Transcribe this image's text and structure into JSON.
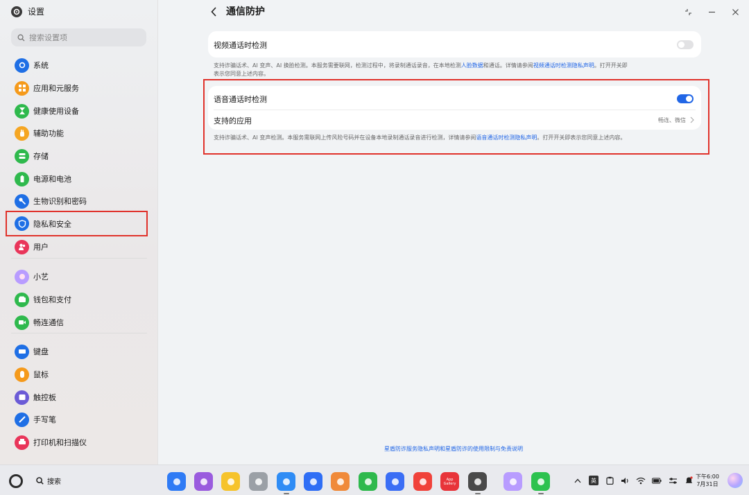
{
  "app": {
    "title": "设置"
  },
  "search": {
    "placeholder": "搜索设置项"
  },
  "sidebar": {
    "items": [
      {
        "label": "系统",
        "icon": "gear-icon",
        "color": "#1f6fe5"
      },
      {
        "label": "应用和元服务",
        "icon": "apps-grid-icon",
        "color": "#f59a1b"
      },
      {
        "label": "健康使用设备",
        "icon": "hourglass-icon",
        "color": "#2fb94d"
      },
      {
        "label": "辅助功能",
        "icon": "hand-icon",
        "color": "#f5a623"
      },
      {
        "label": "存储",
        "icon": "storage-icon",
        "color": "#2fb94d"
      },
      {
        "label": "电源和电池",
        "icon": "battery-icon",
        "color": "#2fb94d"
      },
      {
        "label": "生物识别和密码",
        "icon": "key-icon",
        "color": "#1f6fe5"
      },
      {
        "label": "隐私和安全",
        "icon": "shield-icon",
        "color": "#1f6fe5"
      },
      {
        "label": "用户",
        "icon": "user-icon",
        "color": "#e9355a"
      },
      {
        "label": "小艺",
        "icon": "xiaoyi-orb-icon",
        "color": "#b89cff"
      },
      {
        "label": "钱包和支付",
        "icon": "wallet-icon",
        "color": "#2fb94d"
      },
      {
        "label": "畅连通信",
        "icon": "video-call-icon",
        "color": "#2fb94d"
      },
      {
        "label": "键盘",
        "icon": "keyboard-icon",
        "color": "#1f6fe5"
      },
      {
        "label": "鼠标",
        "icon": "mouse-icon",
        "color": "#f59a1b"
      },
      {
        "label": "触控板",
        "icon": "touchpad-icon",
        "color": "#6b5bd6"
      },
      {
        "label": "手写笔",
        "icon": "pen-icon",
        "color": "#1f6fe5"
      },
      {
        "label": "打印机和扫描仪",
        "icon": "printer-icon",
        "color": "#e9355a"
      }
    ]
  },
  "page": {
    "title": "通信防护",
    "video": {
      "label": "视频通话时检测",
      "enabled": false,
      "desc_line1_a": "支持诈骗话术、AI 变声、AI 换脸检测。本服务需要联网，检测过程中，将录制通话录音，在本地检测",
      "desc_link1": "人脸数据",
      "desc_line1_b": "和通话。详情请参阅",
      "desc_link2": "视频通话时检测隐私声明",
      "desc_line1_c": "。打开开关即",
      "desc_line2": "表示您同意上述内容。"
    },
    "voice": {
      "label": "语音通话时检测",
      "enabled": true,
      "apps_label": "支持的应用",
      "apps_value": "畅连、微信",
      "desc_a": "支持诈骗话术、AI 变声检测。本服务需联网上传风险号码并在设备本地录制通话录音进行检测，详情请参阅",
      "desc_link": "语音通话时检测隐私声明",
      "desc_b": "。打开开关即表示您同意上述内容。"
    },
    "footer_link": "星盾防诈服务隐私声明和星盾防诈的使用限制与免责说明"
  },
  "taskbar": {
    "search_label": "搜索",
    "dock": [
      {
        "icon": "app-center-icon",
        "color": "#2f7bf5"
      },
      {
        "icon": "multitask-icon",
        "color": "#9a5bde"
      },
      {
        "icon": "files-folder-icon",
        "color": "#f6c32b"
      },
      {
        "icon": "trash-icon",
        "color": "#9ba0a6"
      },
      {
        "icon": "browser-icon",
        "color": "#2f8cf5"
      },
      {
        "icon": "mail-icon",
        "color": "#2f6ef5"
      },
      {
        "icon": "gallery-icon",
        "color": "#f08a3a"
      },
      {
        "icon": "messages-icon",
        "color": "#2fb94d"
      },
      {
        "icon": "music-icon",
        "color": "#3b6ef5"
      },
      {
        "icon": "books-icon",
        "color": "#f0423a"
      },
      {
        "icon": "app-gallery-icon",
        "color": "#e8343a"
      },
      {
        "icon": "settings-icon",
        "color": "#4a4a4a"
      },
      {
        "icon": "xiaoyi-icon",
        "color": "#b89cff"
      },
      {
        "icon": "wechat-icon",
        "color": "#2dc24f"
      }
    ],
    "app_gallery_text": "App Gallery",
    "ime_label": "英",
    "time": "下午6:00",
    "date": "7月31日"
  }
}
